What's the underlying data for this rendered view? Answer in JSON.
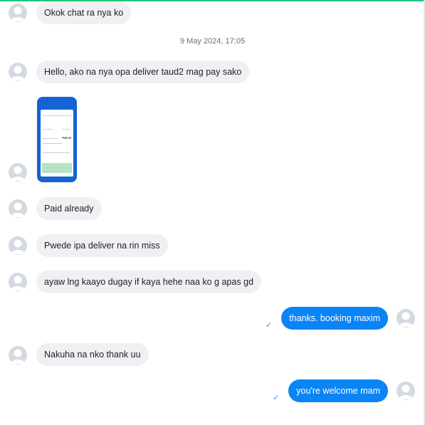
{
  "conversation": {
    "date_separator": "9 May 2024, 17:05",
    "messages": [
      {
        "direction": "incoming",
        "text": "Okok chat ra nya ko"
      },
      {
        "direction": "incoming",
        "text": "Hello, ako na nya opa deliver taud2 mag pay sako"
      },
      {
        "direction": "incoming",
        "type": "image",
        "preview_amount": "P40.00"
      },
      {
        "direction": "incoming",
        "text": "Paid already"
      },
      {
        "direction": "incoming",
        "text": "Pwede ipa deliver na rin miss"
      },
      {
        "direction": "incoming",
        "text": "ayaw lng kaayo dugay if kaya hehe naa ko g apas gd"
      },
      {
        "direction": "outgoing",
        "text": "thanks. booking maxim",
        "status": "delivered"
      },
      {
        "direction": "incoming",
        "text": "Nakuha na nko thank uu"
      },
      {
        "direction": "outgoing",
        "text": "you're welcome mam",
        "status": "delivered"
      }
    ]
  },
  "icons": {
    "avatar": "default-user-avatar-icon",
    "delivered": "checkmark-icon"
  },
  "colors": {
    "accent_line": "#22c47e",
    "incoming_bubble": "#eef0f3",
    "outgoing_bubble": "#0b84f5",
    "avatar_placeholder": "#d4dae1",
    "checkmark": "#3b8ee8"
  }
}
